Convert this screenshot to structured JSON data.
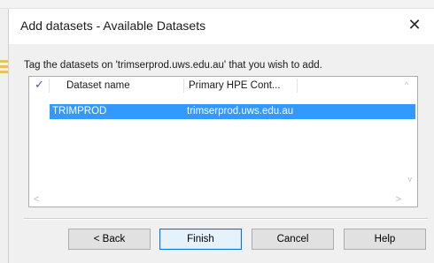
{
  "dialog": {
    "title": "Add datasets - Available Datasets",
    "close_label": "✕",
    "instruction": "Tag the datasets on 'trimserprod.uws.edu.au' that you wish to add."
  },
  "list": {
    "check_mark": "✓",
    "columns": [
      "Dataset name",
      "Primary HPE Cont..."
    ],
    "rows": [
      {
        "name": "TRIMPROD",
        "primary": "trimserprod.uws.edu.au",
        "selected": true
      }
    ],
    "scroll_left": "<",
    "scroll_right": ">",
    "scroll_up": "^",
    "scroll_down": "v"
  },
  "buttons": {
    "back": "< Back",
    "finish": "Finish",
    "cancel": "Cancel",
    "help": "Help"
  }
}
